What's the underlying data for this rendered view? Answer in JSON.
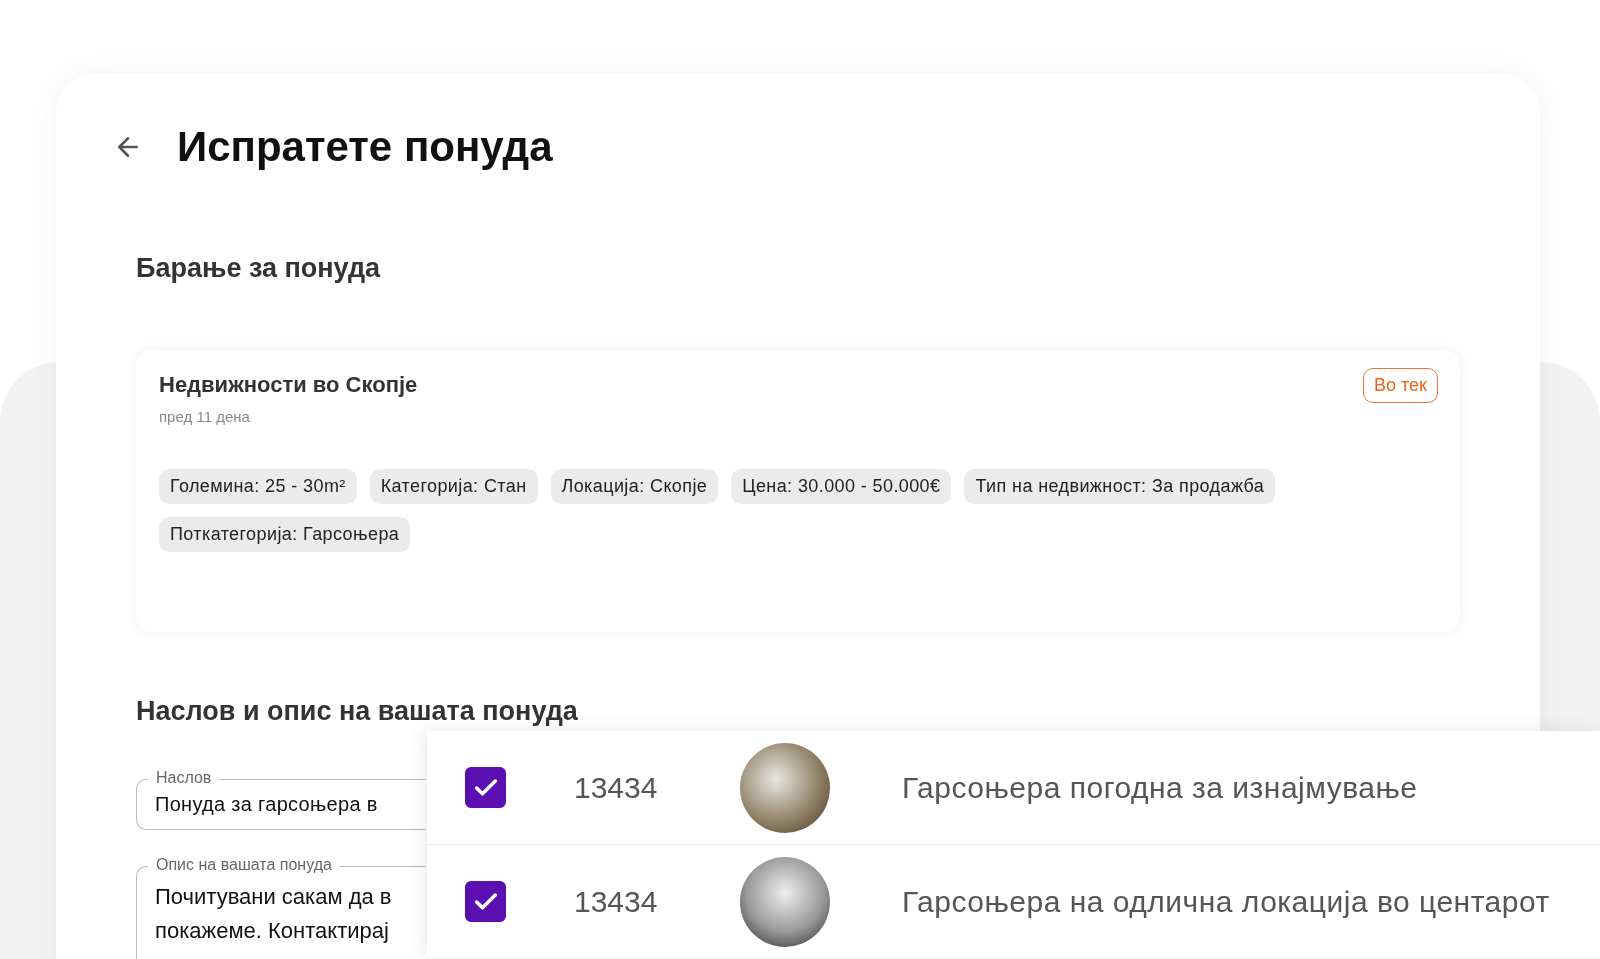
{
  "header": {
    "title": "Испратете понуда"
  },
  "request_section": {
    "heading": "Барање за понуда",
    "card": {
      "title": "Недвижности во Скопје",
      "time": "пред 11 дена",
      "status": "Во тек",
      "tags": [
        "Големина: 25 - 30m²",
        "Категорија: Стан",
        "Локација: Скопје",
        "Цена: 30.000 - 50.000€",
        "Тип на недвижност: За продажба",
        "Поткатегорија: Гарсоњера"
      ]
    }
  },
  "offer_section": {
    "heading": "Наслов и опис на вашата понуда",
    "title_field": {
      "label": "Наслов",
      "value": "Понуда за гарсоњера в"
    },
    "description_field": {
      "label": "Опис на вашата понуда",
      "lines": [
        "Почитувани сакам да в",
        "покажеме. Контактирај"
      ]
    }
  },
  "listings": [
    {
      "checked": true,
      "id": "13434",
      "name": "Гарсоњера погодна за изнајмување"
    },
    {
      "checked": true,
      "id": "13434",
      "name": "Гарсоњера на одлична локација во центарот"
    }
  ]
}
